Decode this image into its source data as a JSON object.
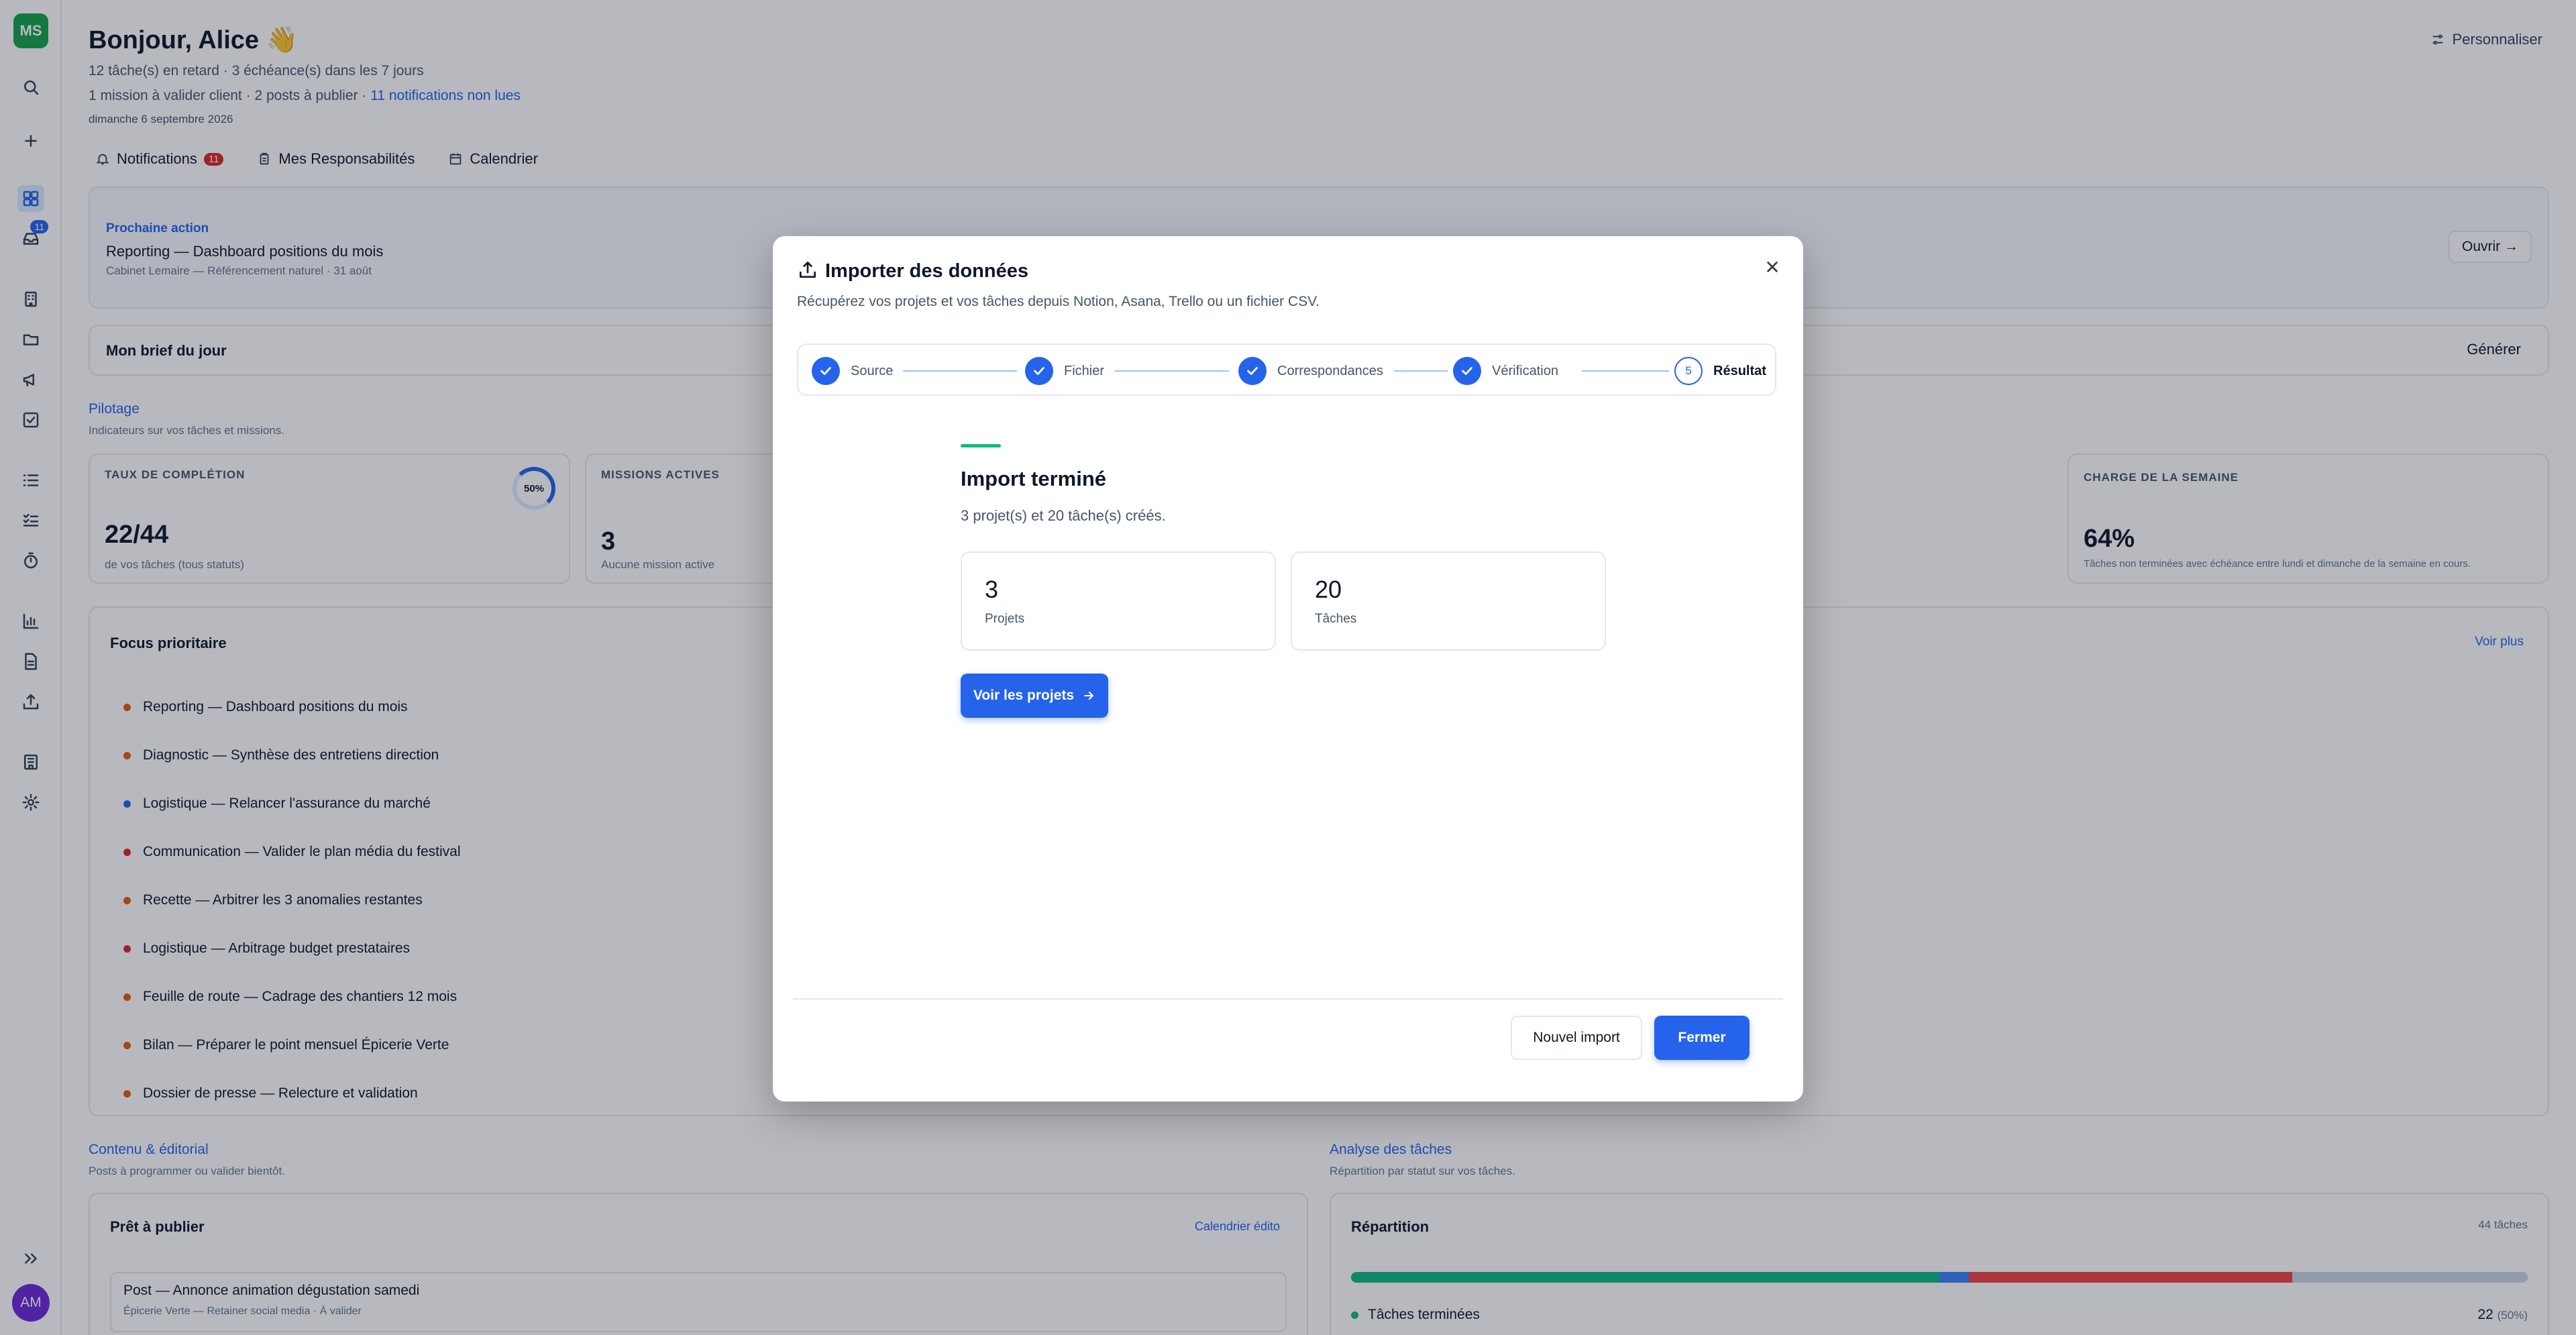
{
  "sidebar": {
    "logo": "MS",
    "inbox_badge": "11",
    "avatar": "AM",
    "icons": [
      "search-icon",
      "plus-icon",
      "dashboard-icon",
      "inbox-icon",
      "building-icon",
      "folder-icon",
      "megaphone-icon",
      "checkbox-icon",
      "list-icon",
      "checklist-icon",
      "timer-icon",
      "chart-icon",
      "document-icon",
      "upload-icon",
      "organization-icon",
      "settings-icon",
      "expand-icon"
    ]
  },
  "header": {
    "greeting": "Bonjour, Alice 👋",
    "line1": "12 tâche(s) en retard · 3 échéance(s) dans les 7 jours",
    "line2_prefix": "1 mission à valider client · 2 posts à publier · ",
    "line2_link": "11 notifications non lues",
    "date": "dimanche 6 septembre 2026",
    "customize": "Personnaliser"
  },
  "tabs": [
    {
      "label": "Notifications",
      "badge": "11"
    },
    {
      "label": "Mes Responsabilités"
    },
    {
      "label": "Calendrier"
    }
  ],
  "next_action": {
    "label": "Prochaine action",
    "title": "Reporting — Dashboard positions du mois",
    "sub": "Cabinet Lemaire — Référencement naturel · 31 août",
    "open": "Ouvrir"
  },
  "brief": {
    "title": "Mon brief du jour",
    "generate": "Générer"
  },
  "pilotage": {
    "title": "Pilotage",
    "sub": "Indicateurs sur vos tâches et missions.",
    "kpis": [
      {
        "title": "TAUX DE COMPLÉTION",
        "value": "22/44",
        "sub": "de vos tâches (tous statuts)",
        "ring": "50%"
      },
      {
        "title": "MISSIONS ACTIVES",
        "value": "3",
        "sub": "Aucune mission active"
      },
      {
        "title": "CHARGE DE LA SEMAINE",
        "value": "64%",
        "sub": "Tâches non terminées avec échéance entre lundi et dimanche de la semaine en cours."
      }
    ]
  },
  "focus": {
    "title": "Focus prioritaire",
    "more": "Voir plus",
    "items": [
      {
        "label": "Reporting — Dashboard positions du mois",
        "color": "#ea580c"
      },
      {
        "label": "Diagnostic — Synthèse des entretiens direction",
        "color": "#ea580c"
      },
      {
        "label": "Logistique — Relancer l'assurance du marché",
        "color": "#2563eb"
      },
      {
        "label": "Communication — Valider le plan média du festival",
        "color": "#dc2626"
      },
      {
        "label": "Recette — Arbitrer les 3 anomalies restantes",
        "color": "#ea580c"
      },
      {
        "label": "Logistique — Arbitrage budget prestataires",
        "color": "#dc2626"
      },
      {
        "label": "Feuille de route — Cadrage des chantiers 12 mois",
        "color": "#ea580c"
      },
      {
        "label": "Bilan — Préparer le point mensuel Épicerie Verte",
        "color": "#ea580c"
      },
      {
        "label": "Dossier de presse — Relecture et validation",
        "color": "#ea580c"
      }
    ]
  },
  "content": {
    "title": "Contenu & éditorial",
    "sub": "Posts à programmer ou valider bientôt.",
    "ready_title": "Prêt à publier",
    "calendar_link": "Calendrier édito",
    "post_title": "Post — Annonce animation dégustation samedi",
    "post_sub": "Épicerie Verte — Retainer social media · À valider"
  },
  "analysis": {
    "title": "Analyse des tâches",
    "sub": "Répartition par statut sur vos tâches.",
    "repartition": "Répartition",
    "total": "44 tâches",
    "done_label": "Tâches terminées",
    "done_value": "22",
    "done_pct": "(50%)"
  },
  "modal": {
    "title": "Importer des données",
    "description": "Récupérez vos projets et vos tâches depuis Notion, Asana, Trello ou un fichier CSV.",
    "steps": [
      {
        "label": "Source",
        "state": "done"
      },
      {
        "label": "Fichier",
        "state": "done"
      },
      {
        "label": "Correspondances",
        "state": "done"
      },
      {
        "label": "Vérification",
        "state": "done"
      },
      {
        "label": "Résultat",
        "state": "current",
        "number": "5"
      }
    ],
    "result_title": "Import terminé",
    "result_sub": "3 projet(s) et 20 tâche(s) créés.",
    "stats": [
      {
        "value": "3",
        "label": "Projets"
      },
      {
        "value": "20",
        "label": "Tâches"
      }
    ],
    "view_projects": "Voir les projets",
    "new_import": "Nouvel import",
    "close": "Fermer"
  },
  "colors": {
    "accent": "#2563eb",
    "success": "#10b981",
    "danger": "#dc2626"
  }
}
